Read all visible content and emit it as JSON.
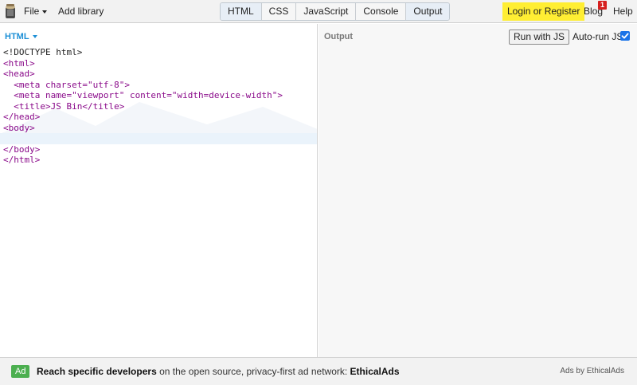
{
  "header": {
    "menu": {
      "file": "File",
      "add_library": "Add library"
    },
    "tabs": [
      {
        "label": "HTML",
        "active": true
      },
      {
        "label": "CSS",
        "active": false
      },
      {
        "label": "JavaScript",
        "active": false
      },
      {
        "label": "Console",
        "active": false
      },
      {
        "label": "Output",
        "active": true
      }
    ],
    "login": "Login or Register",
    "blog": "Blog",
    "blog_badge": "1",
    "help": "Help"
  },
  "editor": {
    "label": "HTML",
    "lines": [
      "<!DOCTYPE html>",
      "<html>",
      "<head>",
      "  <meta charset=\"utf-8\">",
      "  <meta name=\"viewport\" content=\"width=device-width\">",
      "  <title>JS Bin</title>",
      "</head>",
      "<body>",
      "",
      "</body>",
      "</html>"
    ]
  },
  "output": {
    "label": "Output",
    "run_button": "Run with JS",
    "autorun_label": "Auto-run JS",
    "autorun_checked": true
  },
  "footer": {
    "ad_badge": "Ad",
    "ad_strong": "Reach specific developers",
    "ad_middle": " on the open source, privacy-first ad network: ",
    "ad_network": "EthicalAds",
    "ads_by": "Ads by EthicalAds"
  },
  "colors": {
    "accent": "#1c8fd6",
    "login_bg": "#ffee33",
    "badge_red": "#d6201f",
    "ad_green": "#4caf50",
    "checkbox": "#1a73e8"
  }
}
